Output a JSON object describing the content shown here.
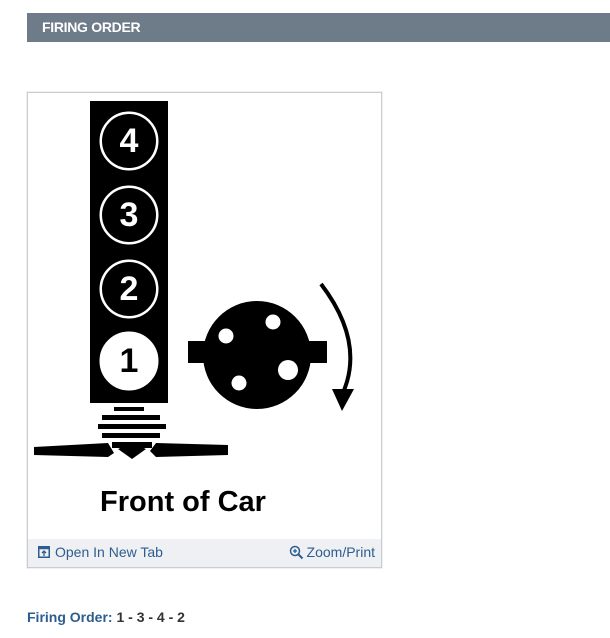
{
  "section": {
    "title": "FIRING ORDER"
  },
  "diagram": {
    "cylinders": [
      "4",
      "3",
      "2",
      "1"
    ],
    "caption": "Front of Car"
  },
  "toolbar": {
    "open_label": "Open In New Tab",
    "zoom_label": "Zoom/Print",
    "open_icon": "open-in-new-tab-icon",
    "zoom_icon": "zoom-in-icon"
  },
  "firing_order": {
    "label": "Firing Order",
    "value": "1 - 3 - 4 - 2"
  },
  "colors": {
    "header_bg": "#6e7b89",
    "link": "#2d5d8f",
    "toolbar_bg": "#eef0f3"
  }
}
